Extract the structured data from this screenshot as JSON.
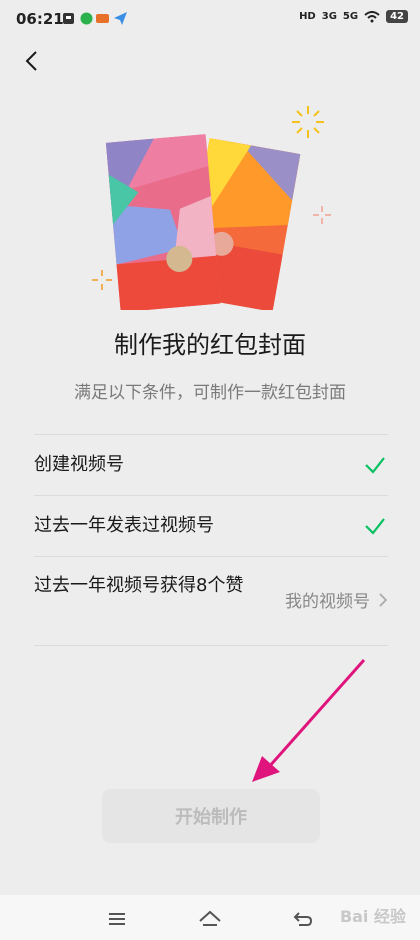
{
  "status_bar": {
    "time": "06:21",
    "indicators": [
      "HD",
      "3G",
      "5G",
      "wifi"
    ],
    "battery": "42"
  },
  "page": {
    "title": "制作我的红包封面",
    "subtitle": "满足以下条件，可制作一款红包封面"
  },
  "conditions": [
    {
      "label": "创建视频号",
      "status": "done"
    },
    {
      "label": "过去一年发表过视频号",
      "status": "done"
    },
    {
      "label": "过去一年视频号获得8个赞",
      "action_label": "我的视频号"
    }
  ],
  "start_button": {
    "label": "开始制作",
    "enabled": false
  },
  "watermark": "Bai 经验",
  "colors": {
    "check": "#07c160",
    "arrow": "#e0147d",
    "button_bg": "#e5e5e5",
    "button_text": "#bcbcbc"
  },
  "icons": [
    "back-icon",
    "check-icon",
    "chevron-right-icon",
    "menu-icon",
    "home-icon",
    "return-icon"
  ]
}
